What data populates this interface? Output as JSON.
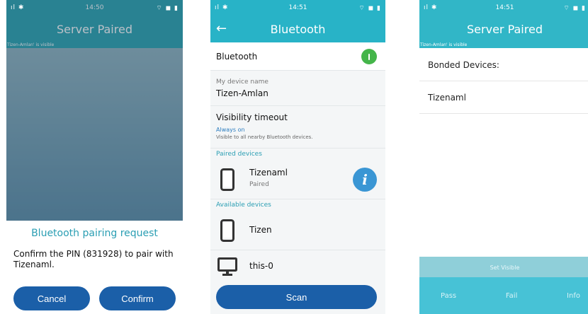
{
  "screen1": {
    "status": {
      "left": "ıl ✱",
      "time": "14:50",
      "right": "⌔ ◼ ▮"
    },
    "title": "Server Paired",
    "visible_text": "Tizen-Amlan' is visible",
    "dialog": {
      "title": "Bluetooth pairing request",
      "message": "Confirm the PIN (831928) to pair with Tizenaml.",
      "cancel": "Cancel",
      "confirm": "Confirm"
    }
  },
  "screen2": {
    "status": {
      "left": "ıl ✱",
      "time": "14:51",
      "right": "⌔ ◼ ▮"
    },
    "title": "Bluetooth",
    "bluetooth_label": "Bluetooth",
    "device_name_label": "My device name",
    "device_name": "Tizen-Amlan",
    "visibility_title": "Visibility timeout",
    "visibility_value": "Always on",
    "visibility_desc": "Visible to all nearby Bluetooth devices.",
    "paired_header": "Paired devices",
    "paired": [
      {
        "name": "Tizenaml",
        "status": "Paired",
        "icon": "phone-icon"
      }
    ],
    "available_header": "Available devices",
    "available": [
      {
        "name": "Tizen",
        "icon": "phone-icon"
      },
      {
        "name": "this-0",
        "icon": "monitor-icon"
      }
    ],
    "scan": "Scan"
  },
  "screen3": {
    "status": {
      "left": "ıl ✱",
      "time": "14:51",
      "right": "⌔ ◼ ▮"
    },
    "title": "Server Paired",
    "visible_text": "Tizen-Amlan' is visible",
    "bonded_header": "Bonded Devices:",
    "bonded": [
      "Tizenaml"
    ],
    "set_visible": "Set Visible",
    "nav": {
      "pass": "Pass",
      "fail": "Fail",
      "info": "Info"
    }
  },
  "colors": {
    "teal": "#2aa4b2",
    "button_blue": "#1b5fa8",
    "toggle_green": "#44b54a",
    "info_blue": "#3a96d4"
  }
}
